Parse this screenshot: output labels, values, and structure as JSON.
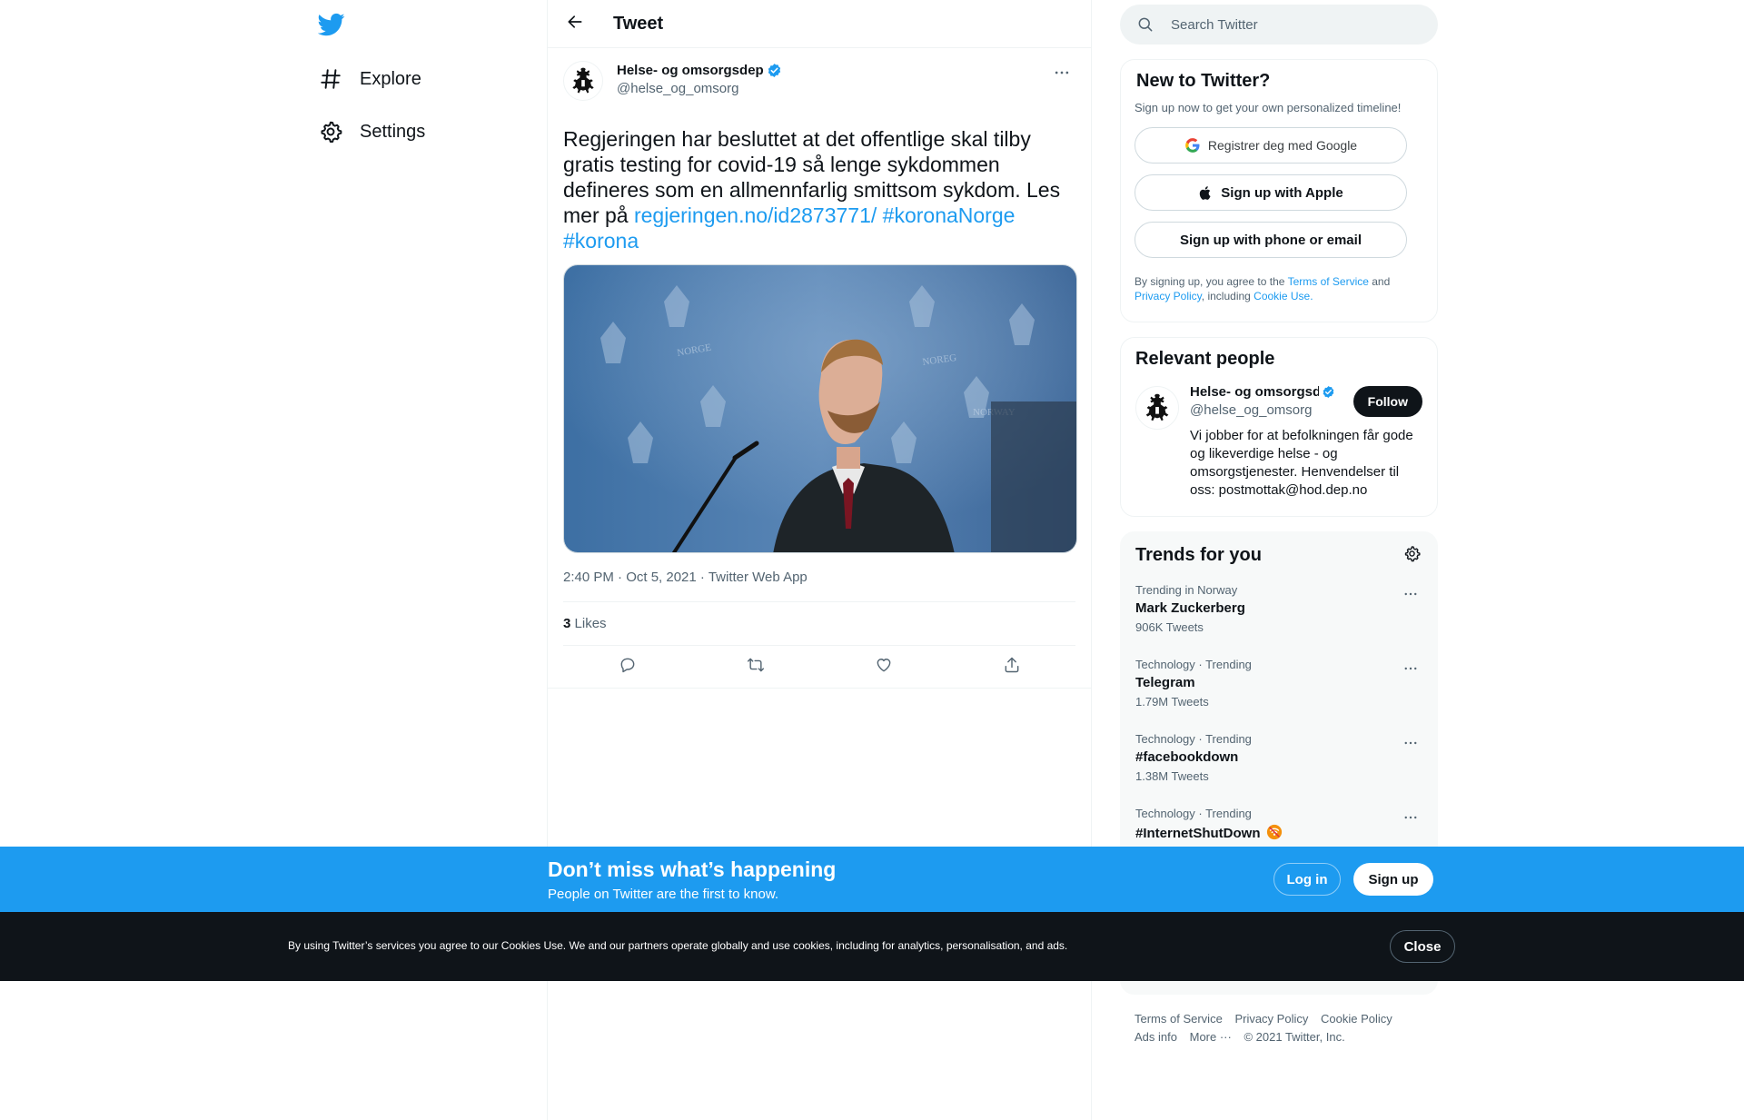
{
  "colors": {
    "accent": "#1d9bf0",
    "text": "#0f1419",
    "muted": "#536471",
    "dark": "#0f1419"
  },
  "nav": {
    "logo_icon": "twitter-bird-icon",
    "items": [
      {
        "label": "Explore",
        "icon": "hashtag-icon"
      },
      {
        "label": "Settings",
        "icon": "gear-icon"
      }
    ]
  },
  "header": {
    "title": "Tweet",
    "back_icon": "arrow-left-icon"
  },
  "tweet": {
    "author_name": "Helse- og omsorgsdep",
    "author_handle": "@helse_og_omsorg",
    "text": "Regjeringen har besluttet at det offentlige skal tilby gratis testing for covid-19 så lenge sykdommen defineres som en allmennfarlig smittsom sykdom. Les mer på ",
    "link": "regjeringen.no/id2873771/",
    "hashtag1": "#koronaNorge",
    "hashtag2": "#korona",
    "timestamp": "2:40 PM · Oct 5, 2021 · ",
    "source": "Twitter Web App",
    "likes_count": "3",
    "likes_label": "Likes"
  },
  "search": {
    "placeholder": "Search Twitter"
  },
  "signup_card": {
    "title": "New to Twitter?",
    "subtitle": "Sign up now to get your own personalized timeline!",
    "google_label": "Registrer deg med Google",
    "apple_label": "Sign up with Apple",
    "phone_label": "Sign up with phone or email",
    "legal_prefix": "By signing up, you agree to the ",
    "terms": "Terms of Service",
    "and": " and",
    "privacy": "Privacy Policy",
    "including": ", including ",
    "cookie": "Cookie Use."
  },
  "relevant": {
    "title": "Relevant people",
    "name": "Helse- og omsorgsdep",
    "handle": "@helse_og_omsorg",
    "follow_label": "Follow",
    "bio": "Vi jobber for at befolkningen får gode og likeverdige helse - og omsorgstjenester. Henvendelser til oss: postmottak@hod.dep.no"
  },
  "trends": {
    "title": "Trends for you",
    "items": [
      {
        "context": "Trending in Norway",
        "title": "Mark Zuckerberg",
        "count": "906K Tweets"
      },
      {
        "context": "Technology · Trending",
        "title": "Telegram",
        "count": "1.79M Tweets"
      },
      {
        "context": "Technology · Trending",
        "title": "#facebookdown",
        "count": "1.38M Tweets"
      },
      {
        "context": "Technology · Trending",
        "title": "#InternetShutDown",
        "count": ""
      }
    ]
  },
  "footer": {
    "links": [
      "Terms of Service",
      "Privacy Policy",
      "Cookie Policy",
      "Ads info",
      "More ···"
    ],
    "copyright": "© 2021 Twitter, Inc."
  },
  "banner": {
    "title": "Don’t miss what’s happening",
    "subtitle": "People on Twitter are the first to know.",
    "login_label": "Log in",
    "signup_label": "Sign up"
  },
  "cookie_bar": {
    "text": "By using Twitter’s services you agree to our Cookies Use. We and our partners operate globally and use cookies, including for analytics, personalisation, and ads.",
    "close_label": "Close"
  }
}
